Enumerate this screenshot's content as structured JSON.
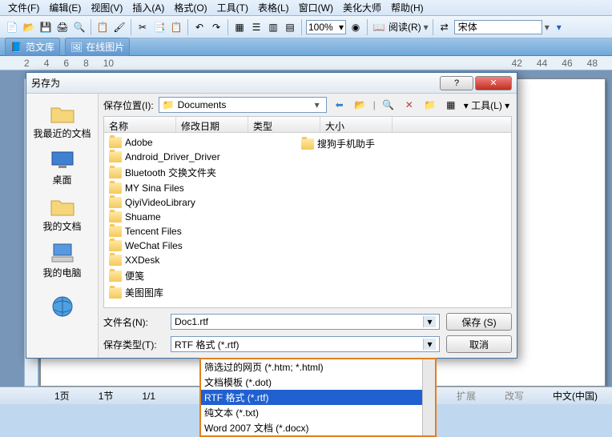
{
  "menu": {
    "file": "文件(F)",
    "edit": "编辑(E)",
    "view": "视图(V)",
    "insert": "插入(A)",
    "format": "格式(O)",
    "tools": "工具(T)",
    "table": "表格(L)",
    "window": "窗口(W)",
    "beautify": "美化大师",
    "help": "帮助(H)"
  },
  "toolbar": {
    "zoom": "100%",
    "read": "阅读(R)",
    "font": "宋体"
  },
  "bar2": {
    "wenku": "范文库",
    "img": "在线图片"
  },
  "ruler_nums": [
    "2",
    "4",
    "6",
    "8",
    "10",
    "42",
    "44",
    "46",
    "48"
  ],
  "status": {
    "page": "1页",
    "sec": "1节",
    "pos": "1/1",
    "ext": "扩展",
    "rev": "改写",
    "lang": "中文(中国)"
  },
  "dialog": {
    "title": "另存为",
    "location_label": "保存位置(I):",
    "location_value": "Documents",
    "tools": "工具(L)",
    "places": [
      {
        "key": "recent",
        "label": "我最近的文档"
      },
      {
        "key": "desktop",
        "label": "桌面"
      },
      {
        "key": "mydocs",
        "label": "我的文档"
      },
      {
        "key": "mycomputer",
        "label": "我的电脑"
      },
      {
        "key": "net",
        "label": ""
      }
    ],
    "headers": {
      "name": "名称",
      "modified": "修改日期",
      "type": "类型",
      "size": "大小"
    },
    "folders_col1": [
      "Adobe",
      "Android_Driver_Driver",
      "Bluetooth 交换文件夹",
      "MY Sina Files",
      "QiyiVideoLibrary",
      "Shuame",
      "Tencent Files",
      "WeChat Files",
      "XXDesk",
      "便笺",
      "美图图库"
    ],
    "folders_col2": [
      "搜狗手机助手"
    ],
    "filename_label": "文件名(N):",
    "filename_value": "Doc1.rtf",
    "filetype_label": "保存类型(T):",
    "filetype_value": "RTF 格式 (*.rtf)",
    "save": "保存 (S)",
    "cancel": "取消"
  },
  "dropdown": {
    "options": [
      "筛选过的网页 (*.htm; *.html)",
      "文档模板 (*.dot)",
      "RTF 格式 (*.rtf)",
      "纯文本 (*.txt)",
      "Word 2007 文档 (*.docx)"
    ],
    "selected_index": 2
  }
}
